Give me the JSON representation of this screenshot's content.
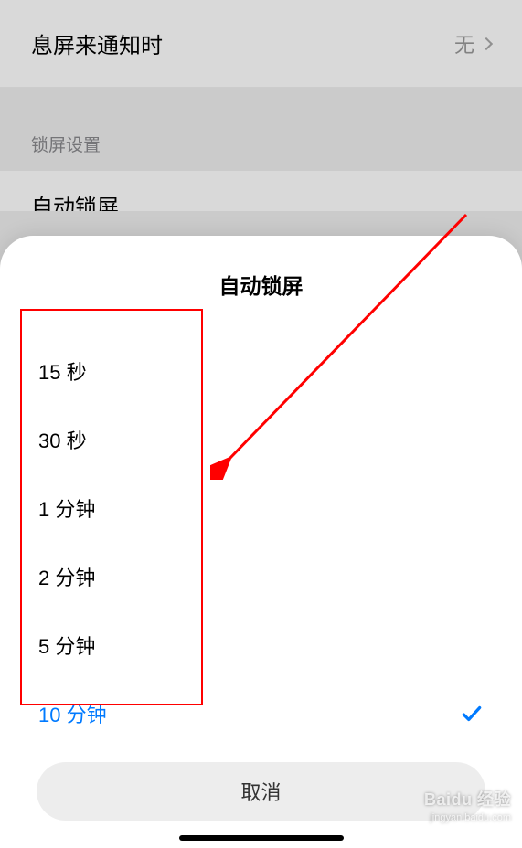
{
  "background": {
    "row1_title": "息屏来通知时",
    "row1_value": "无",
    "section_header": "锁屏设置",
    "row2_title": "自动锁屏"
  },
  "sheet": {
    "title": "自动锁屏",
    "options": [
      {
        "label": "15 秒",
        "selected": false
      },
      {
        "label": "30 秒",
        "selected": false
      },
      {
        "label": "1 分钟",
        "selected": false
      },
      {
        "label": "2 分钟",
        "selected": false
      },
      {
        "label": "5 分钟",
        "selected": false
      },
      {
        "label": "10 分钟",
        "selected": true
      }
    ],
    "cancel": "取消"
  },
  "watermark": {
    "brand": "Baidu 经验",
    "url": "jingyan.baidu.com"
  }
}
